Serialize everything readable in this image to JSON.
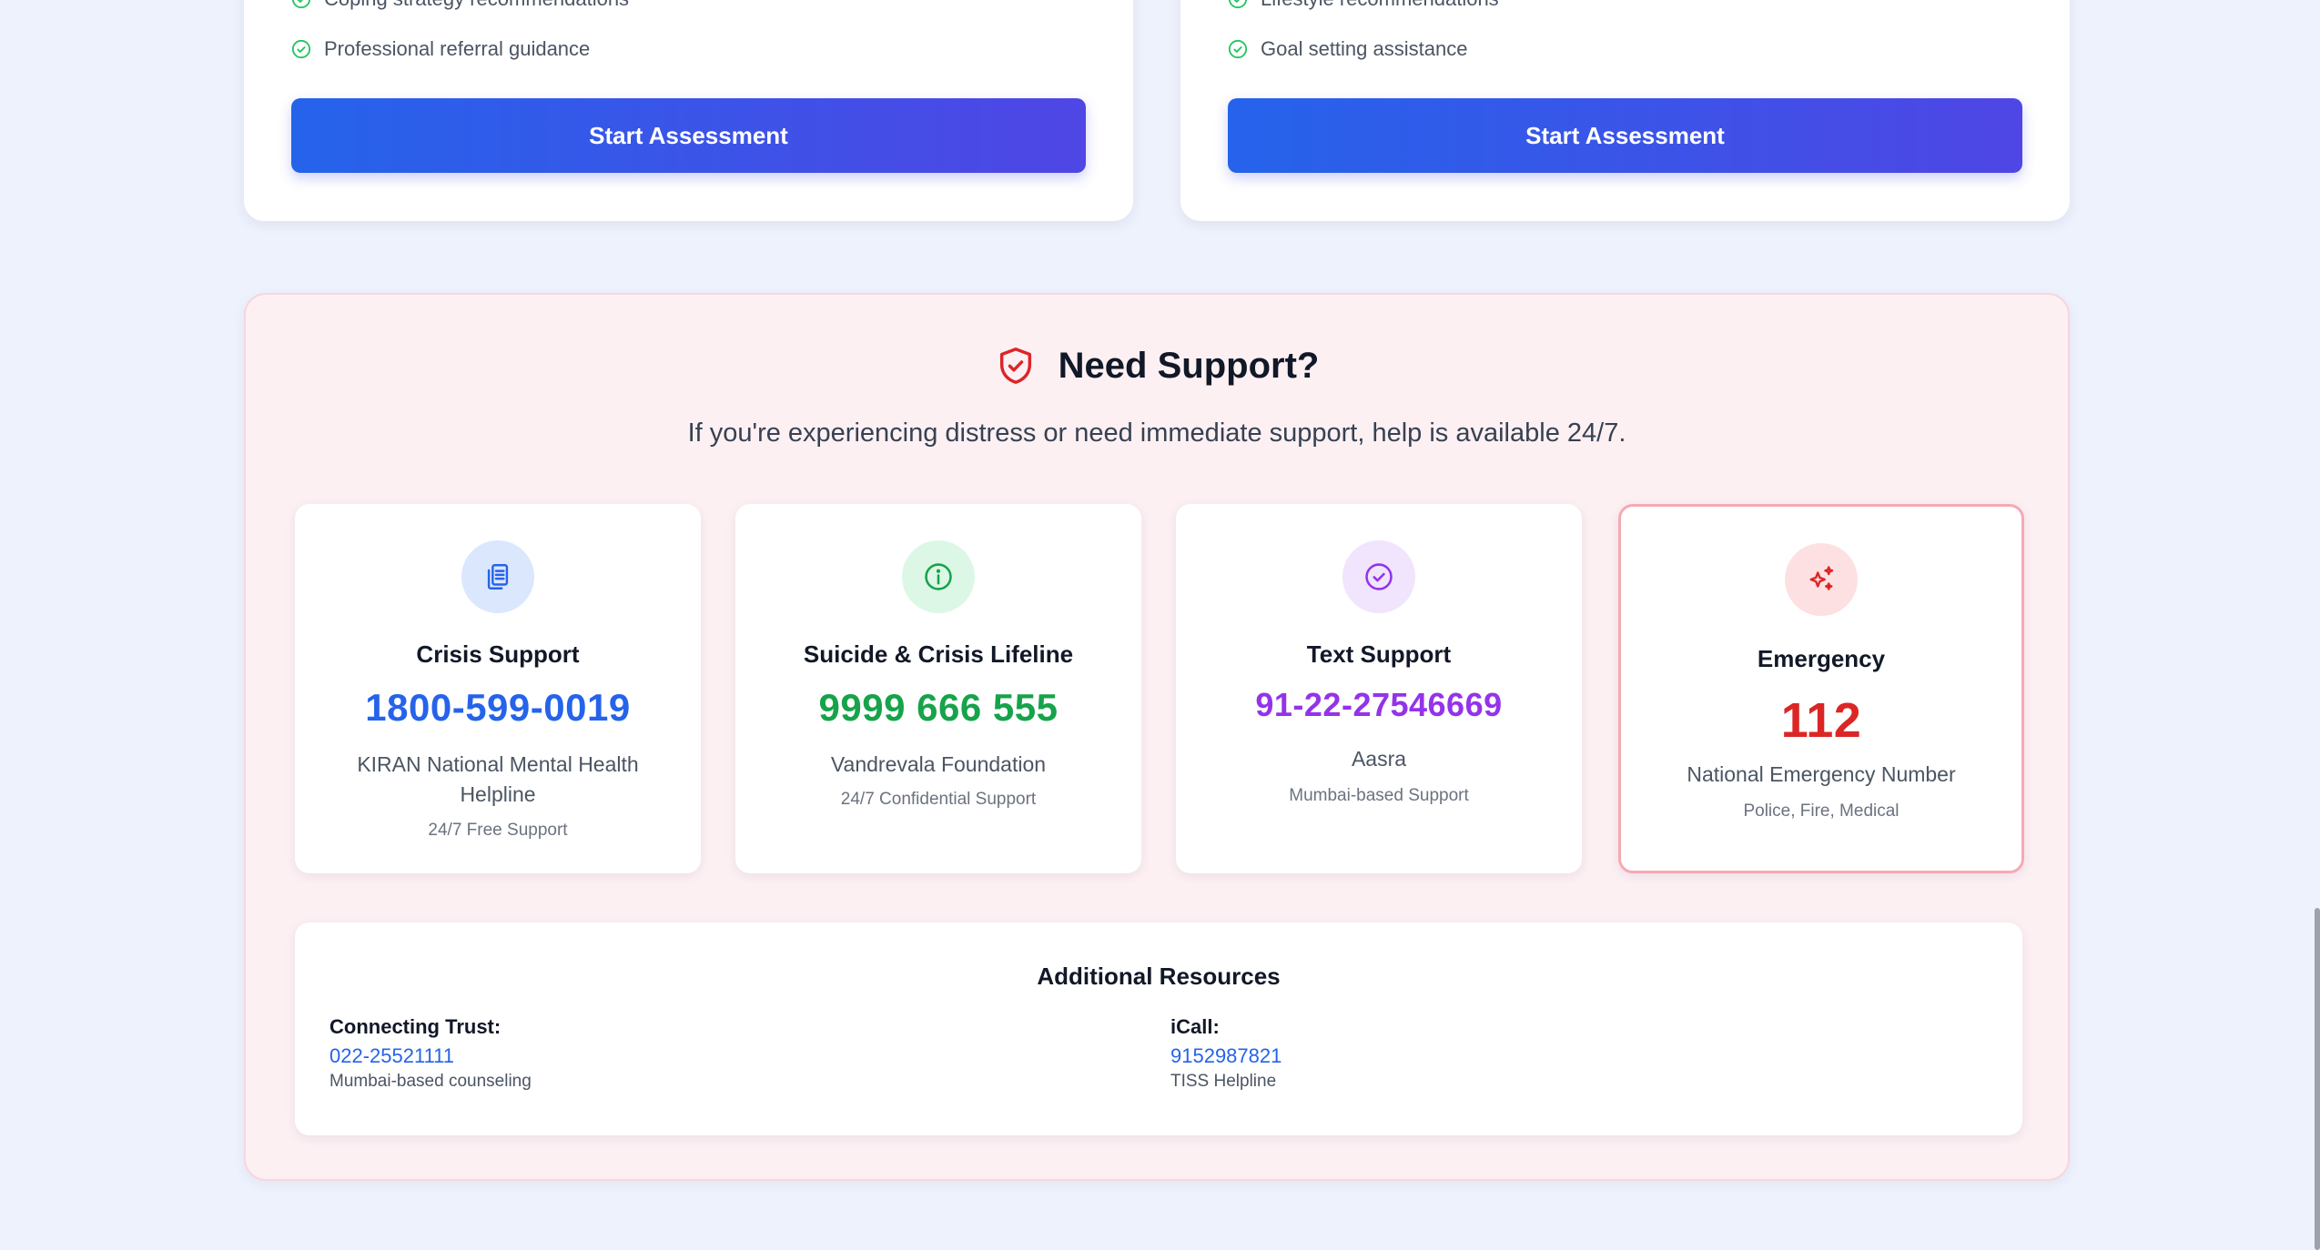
{
  "assessment_cards": [
    {
      "features": [
        "Coping strategy recommendations",
        "Professional referral guidance"
      ],
      "button_label": "Start Assessment"
    },
    {
      "features": [
        "Lifestyle recommendations",
        "Goal setting assistance"
      ],
      "button_label": "Start Assessment"
    }
  ],
  "support": {
    "title": "Need Support?",
    "subtitle": "If you're experiencing distress or need immediate support, help is available 24/7.",
    "helplines": [
      {
        "name": "Crisis Support",
        "number": "1800-599-0019",
        "organization": "KIRAN National Mental Health Helpline",
        "note": "24/7 Free Support",
        "icon": "clipboard-icon",
        "color": "#2563eb",
        "icon_bg": "#dbe7fd"
      },
      {
        "name": "Suicide & Crisis Lifeline",
        "number": "9999 666 555",
        "organization": "Vandrevala Foundation",
        "note": "24/7 Confidential Support",
        "icon": "info-icon",
        "color": "#16a34a",
        "icon_bg": "#dcf7e6"
      },
      {
        "name": "Text Support",
        "number": "91-22-27546669",
        "organization": "Aasra",
        "note": "Mumbai-based Support",
        "icon": "check-circle-icon",
        "color": "#9333ea",
        "icon_bg": "#f1e4fd"
      },
      {
        "name": "Emergency",
        "number": "112",
        "organization": "National Emergency Number",
        "note": "Police, Fire, Medical",
        "icon": "sparkles-icon",
        "color": "#dc2626",
        "icon_bg": "#fde0e2"
      }
    ],
    "resources": {
      "title": "Additional Resources",
      "items": [
        {
          "label": "Connecting Trust:",
          "phone": "022-25521111",
          "description": "Mumbai-based counseling"
        },
        {
          "label": "iCall:",
          "phone": "9152987821",
          "description": "TISS Helpline"
        }
      ]
    }
  },
  "colors": {
    "accent_start": "#2563eb",
    "accent_end": "#4f46e5",
    "check_green": "#22c55e",
    "shield_red": "#dc2626"
  }
}
